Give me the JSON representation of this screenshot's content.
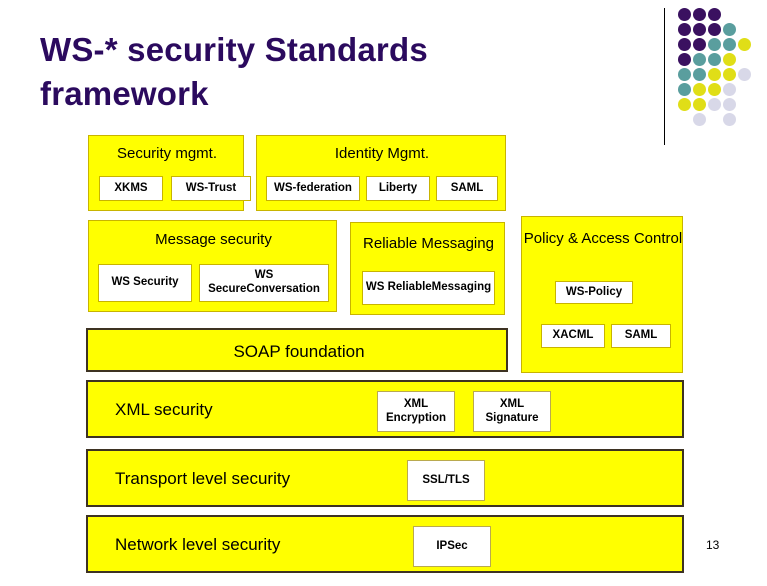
{
  "slide": {
    "title_line1": "WS-* security Standards",
    "title_line2": "framework",
    "title_color": "#2b0a5e",
    "page_number": "13",
    "background_color": "#ffffff",
    "box_fill_color": "#ffff00"
  },
  "decoration": {
    "name": "dot-grid",
    "colors": {
      "purple": "#3a1160",
      "teal": "#5a9e9e",
      "yellow": "#e0de17",
      "lavender": "#d8d8e8"
    },
    "dots": [
      {
        "col": 0,
        "row": 0,
        "color": "purple"
      },
      {
        "col": 1,
        "row": 0,
        "color": "purple"
      },
      {
        "col": 2,
        "row": 0,
        "color": "purple"
      },
      {
        "col": 0,
        "row": 1,
        "color": "purple"
      },
      {
        "col": 1,
        "row": 1,
        "color": "purple"
      },
      {
        "col": 2,
        "row": 1,
        "color": "purple"
      },
      {
        "col": 3,
        "row": 1,
        "color": "teal"
      },
      {
        "col": 0,
        "row": 2,
        "color": "purple"
      },
      {
        "col": 1,
        "row": 2,
        "color": "purple"
      },
      {
        "col": 2,
        "row": 2,
        "color": "teal"
      },
      {
        "col": 3,
        "row": 2,
        "color": "teal"
      },
      {
        "col": 4,
        "row": 2,
        "color": "yellow"
      },
      {
        "col": 0,
        "row": 3,
        "color": "purple"
      },
      {
        "col": 1,
        "row": 3,
        "color": "teal"
      },
      {
        "col": 2,
        "row": 3,
        "color": "teal"
      },
      {
        "col": 3,
        "row": 3,
        "color": "yellow"
      },
      {
        "col": 0,
        "row": 4,
        "color": "teal"
      },
      {
        "col": 1,
        "row": 4,
        "color": "teal"
      },
      {
        "col": 2,
        "row": 4,
        "color": "yellow"
      },
      {
        "col": 3,
        "row": 4,
        "color": "yellow"
      },
      {
        "col": 4,
        "row": 4,
        "color": "lavender"
      },
      {
        "col": 0,
        "row": 5,
        "color": "teal"
      },
      {
        "col": 1,
        "row": 5,
        "color": "yellow"
      },
      {
        "col": 2,
        "row": 5,
        "color": "yellow"
      },
      {
        "col": 3,
        "row": 5,
        "color": "lavender"
      },
      {
        "col": 0,
        "row": 6,
        "color": "yellow"
      },
      {
        "col": 1,
        "row": 6,
        "color": "yellow"
      },
      {
        "col": 2,
        "row": 6,
        "color": "lavender"
      },
      {
        "col": 3,
        "row": 6,
        "color": "lavender"
      },
      {
        "col": 1,
        "row": 7,
        "color": "lavender"
      },
      {
        "col": 3,
        "row": 7,
        "color": "lavender"
      }
    ]
  },
  "diagram": {
    "security_mgmt": {
      "title": "Security mgmt.",
      "items": [
        "XKMS",
        "WS-Trust"
      ]
    },
    "identity_mgmt": {
      "title": "Identity Mgmt.",
      "items": [
        "WS-federation",
        "Liberty",
        "SAML"
      ]
    },
    "message_security": {
      "title": "Message security",
      "items": [
        "WS Security",
        "WS SecureConversation"
      ]
    },
    "reliable_messaging": {
      "title": "Reliable Messaging",
      "items": [
        "WS ReliableMessaging"
      ]
    },
    "policy_access_control": {
      "title": "Policy & Access Control",
      "items": [
        "WS-Policy",
        "XACML",
        "SAML"
      ]
    },
    "soap_foundation": {
      "title": "SOAP foundation"
    },
    "xml_security": {
      "title": "XML security",
      "items": [
        "XML Encryption",
        "XML Signature"
      ]
    },
    "transport_level_security": {
      "title": "Transport level security",
      "items": [
        "SSL/TLS"
      ]
    },
    "network_level_security": {
      "title": "Network level security",
      "items": [
        "IPSec"
      ]
    }
  }
}
